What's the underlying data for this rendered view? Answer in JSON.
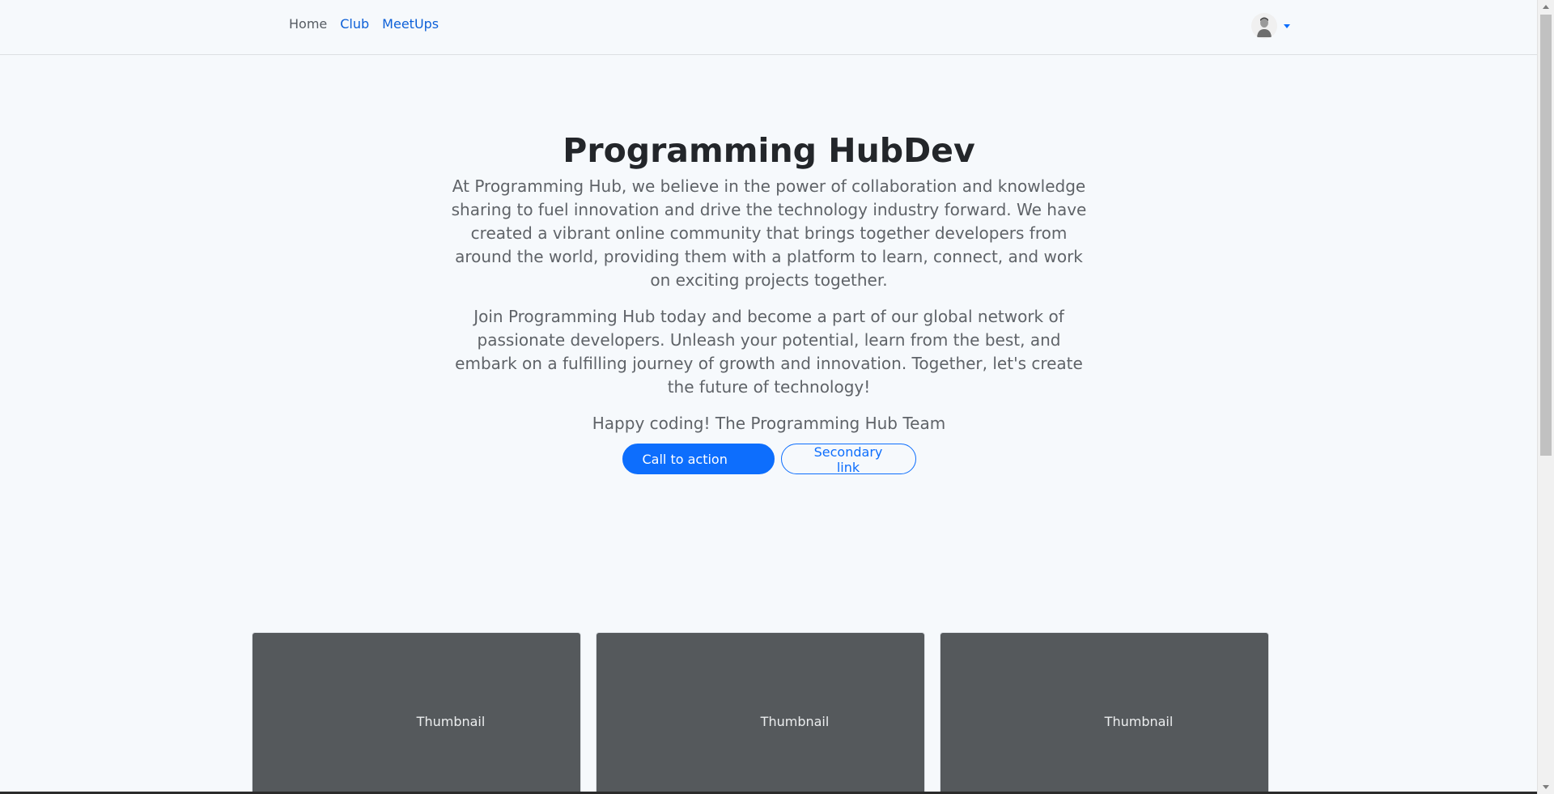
{
  "nav": {
    "links": [
      {
        "label": "Home"
      },
      {
        "label": "Club"
      },
      {
        "label": "MeetUps"
      }
    ]
  },
  "user_menu": {
    "avatar_icon": "user-avatar-icon",
    "caret_icon": "caret-down-icon"
  },
  "hero": {
    "title": "Programming HubDev",
    "paragraph1": "At Programming Hub, we believe in the power of collaboration and knowledge sharing to fuel innovation and drive the technology industry forward. We have created a vibrant online community that brings together developers from around the world, providing them with a platform to learn, connect, and work on exciting projects together.",
    "paragraph2": "Join Programming Hub today and become a part of our global network of passionate developers. Unleash your potential, learn from the best, and embark on a fulfilling journey of growth and innovation. Together, let's create the future of technology!",
    "signoff": "Happy coding! The Programming Hub Team",
    "primary_button": "Call to action",
    "secondary_button": "Secondary link"
  },
  "cards": [
    {
      "label": "Thumbnail"
    },
    {
      "label": "Thumbnail"
    },
    {
      "label": "Thumbnail"
    }
  ],
  "colors": {
    "accent": "#0d6efd",
    "background": "#f6f9fc",
    "card": "#55595c"
  }
}
